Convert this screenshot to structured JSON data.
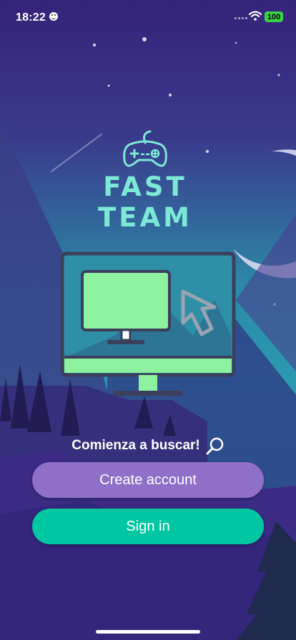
{
  "status_bar": {
    "time": "18:22",
    "battery": "100",
    "battery_color": "#38d048"
  },
  "logo": {
    "title": "FAST TEAM",
    "icon": "gamepad-icon",
    "color": "#7de8d6"
  },
  "illustration": {
    "icons": [
      "monitor-icon",
      "cursor-icon",
      "moon-icon"
    ]
  },
  "tagline": {
    "text": "Comienza a buscar!",
    "icon": "search-icon"
  },
  "buttons": {
    "create_account": "Create account",
    "sign_in": "Sign in"
  },
  "colors": {
    "create_button": "#8f6fc7",
    "signin_button": "#00c7a1",
    "accent_green": "#8ef19f",
    "sky_top": "#35237a",
    "sky_bottom": "#2b9ab0"
  }
}
